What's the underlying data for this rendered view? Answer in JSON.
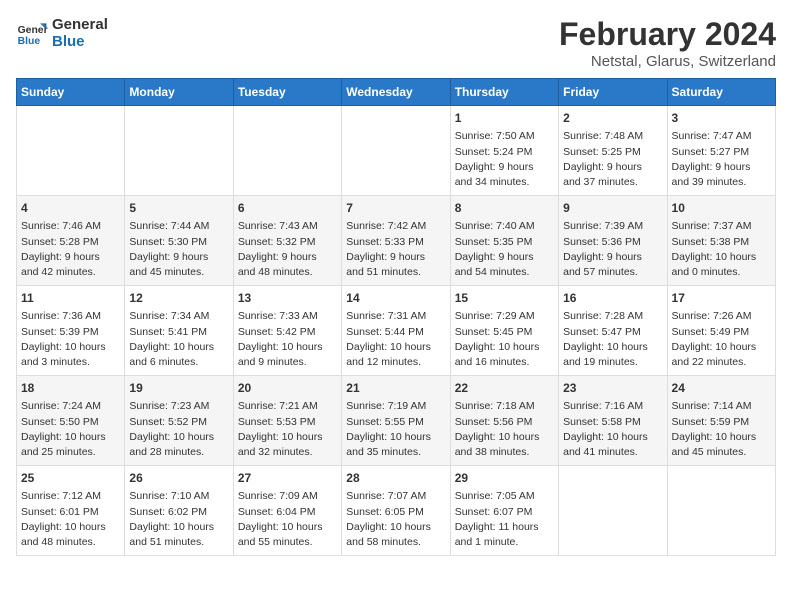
{
  "header": {
    "logo_line1": "General",
    "logo_line2": "Blue",
    "month": "February 2024",
    "location": "Netstal, Glarus, Switzerland"
  },
  "weekdays": [
    "Sunday",
    "Monday",
    "Tuesday",
    "Wednesday",
    "Thursday",
    "Friday",
    "Saturday"
  ],
  "weeks": [
    [
      {
        "day": "",
        "info": ""
      },
      {
        "day": "",
        "info": ""
      },
      {
        "day": "",
        "info": ""
      },
      {
        "day": "",
        "info": ""
      },
      {
        "day": "1",
        "info": "Sunrise: 7:50 AM\nSunset: 5:24 PM\nDaylight: 9 hours\nand 34 minutes."
      },
      {
        "day": "2",
        "info": "Sunrise: 7:48 AM\nSunset: 5:25 PM\nDaylight: 9 hours\nand 37 minutes."
      },
      {
        "day": "3",
        "info": "Sunrise: 7:47 AM\nSunset: 5:27 PM\nDaylight: 9 hours\nand 39 minutes."
      }
    ],
    [
      {
        "day": "4",
        "info": "Sunrise: 7:46 AM\nSunset: 5:28 PM\nDaylight: 9 hours\nand 42 minutes."
      },
      {
        "day": "5",
        "info": "Sunrise: 7:44 AM\nSunset: 5:30 PM\nDaylight: 9 hours\nand 45 minutes."
      },
      {
        "day": "6",
        "info": "Sunrise: 7:43 AM\nSunset: 5:32 PM\nDaylight: 9 hours\nand 48 minutes."
      },
      {
        "day": "7",
        "info": "Sunrise: 7:42 AM\nSunset: 5:33 PM\nDaylight: 9 hours\nand 51 minutes."
      },
      {
        "day": "8",
        "info": "Sunrise: 7:40 AM\nSunset: 5:35 PM\nDaylight: 9 hours\nand 54 minutes."
      },
      {
        "day": "9",
        "info": "Sunrise: 7:39 AM\nSunset: 5:36 PM\nDaylight: 9 hours\nand 57 minutes."
      },
      {
        "day": "10",
        "info": "Sunrise: 7:37 AM\nSunset: 5:38 PM\nDaylight: 10 hours\nand 0 minutes."
      }
    ],
    [
      {
        "day": "11",
        "info": "Sunrise: 7:36 AM\nSunset: 5:39 PM\nDaylight: 10 hours\nand 3 minutes."
      },
      {
        "day": "12",
        "info": "Sunrise: 7:34 AM\nSunset: 5:41 PM\nDaylight: 10 hours\nand 6 minutes."
      },
      {
        "day": "13",
        "info": "Sunrise: 7:33 AM\nSunset: 5:42 PM\nDaylight: 10 hours\nand 9 minutes."
      },
      {
        "day": "14",
        "info": "Sunrise: 7:31 AM\nSunset: 5:44 PM\nDaylight: 10 hours\nand 12 minutes."
      },
      {
        "day": "15",
        "info": "Sunrise: 7:29 AM\nSunset: 5:45 PM\nDaylight: 10 hours\nand 16 minutes."
      },
      {
        "day": "16",
        "info": "Sunrise: 7:28 AM\nSunset: 5:47 PM\nDaylight: 10 hours\nand 19 minutes."
      },
      {
        "day": "17",
        "info": "Sunrise: 7:26 AM\nSunset: 5:49 PM\nDaylight: 10 hours\nand 22 minutes."
      }
    ],
    [
      {
        "day": "18",
        "info": "Sunrise: 7:24 AM\nSunset: 5:50 PM\nDaylight: 10 hours\nand 25 minutes."
      },
      {
        "day": "19",
        "info": "Sunrise: 7:23 AM\nSunset: 5:52 PM\nDaylight: 10 hours\nand 28 minutes."
      },
      {
        "day": "20",
        "info": "Sunrise: 7:21 AM\nSunset: 5:53 PM\nDaylight: 10 hours\nand 32 minutes."
      },
      {
        "day": "21",
        "info": "Sunrise: 7:19 AM\nSunset: 5:55 PM\nDaylight: 10 hours\nand 35 minutes."
      },
      {
        "day": "22",
        "info": "Sunrise: 7:18 AM\nSunset: 5:56 PM\nDaylight: 10 hours\nand 38 minutes."
      },
      {
        "day": "23",
        "info": "Sunrise: 7:16 AM\nSunset: 5:58 PM\nDaylight: 10 hours\nand 41 minutes."
      },
      {
        "day": "24",
        "info": "Sunrise: 7:14 AM\nSunset: 5:59 PM\nDaylight: 10 hours\nand 45 minutes."
      }
    ],
    [
      {
        "day": "25",
        "info": "Sunrise: 7:12 AM\nSunset: 6:01 PM\nDaylight: 10 hours\nand 48 minutes."
      },
      {
        "day": "26",
        "info": "Sunrise: 7:10 AM\nSunset: 6:02 PM\nDaylight: 10 hours\nand 51 minutes."
      },
      {
        "day": "27",
        "info": "Sunrise: 7:09 AM\nSunset: 6:04 PM\nDaylight: 10 hours\nand 55 minutes."
      },
      {
        "day": "28",
        "info": "Sunrise: 7:07 AM\nSunset: 6:05 PM\nDaylight: 10 hours\nand 58 minutes."
      },
      {
        "day": "29",
        "info": "Sunrise: 7:05 AM\nSunset: 6:07 PM\nDaylight: 11 hours\nand 1 minute."
      },
      {
        "day": "",
        "info": ""
      },
      {
        "day": "",
        "info": ""
      }
    ]
  ]
}
